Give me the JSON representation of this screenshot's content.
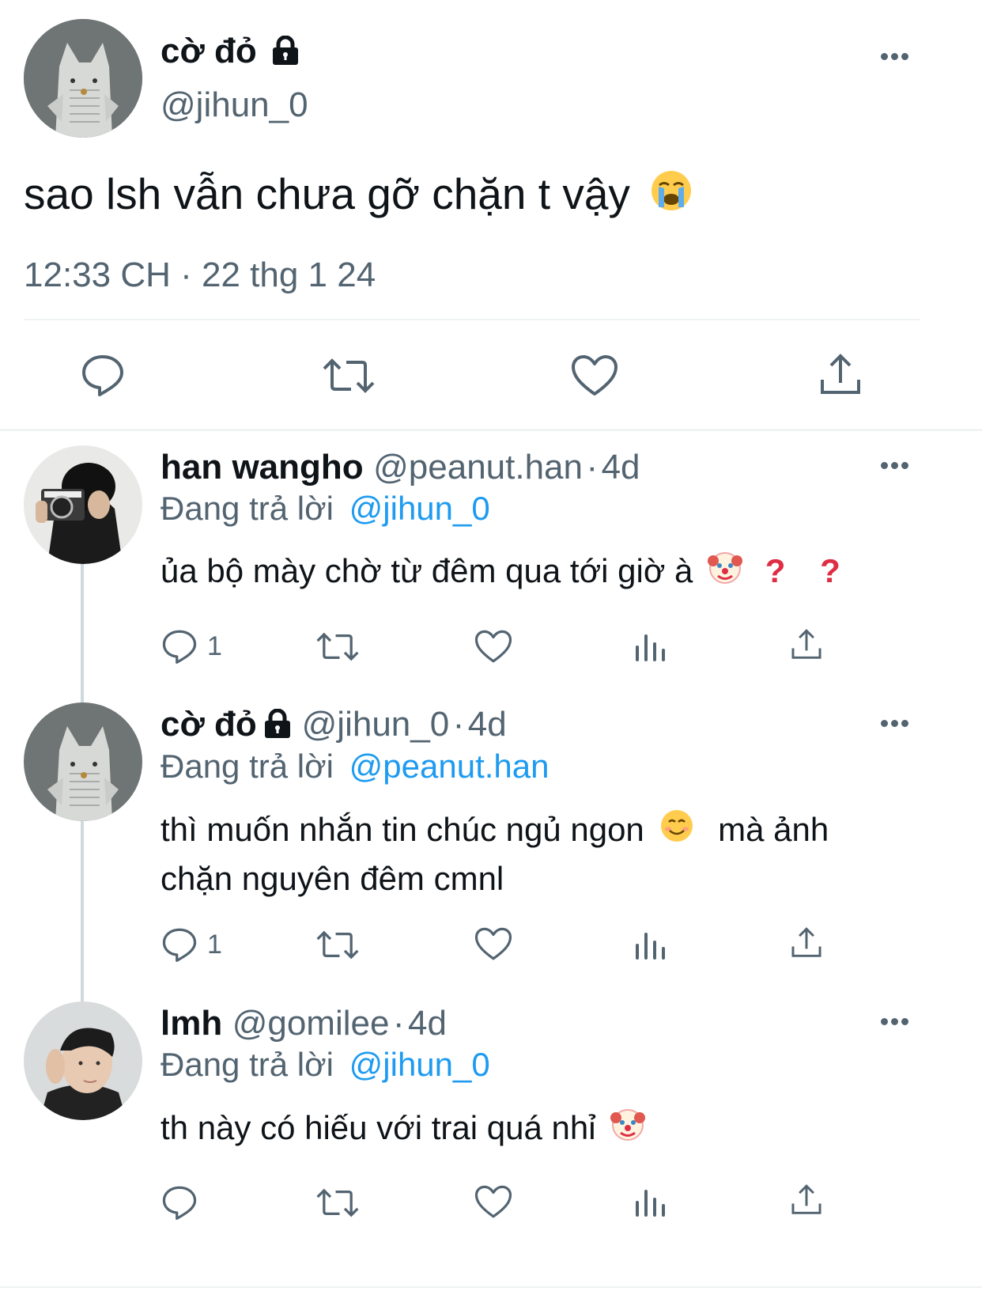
{
  "main_tweet": {
    "display_name": "cờ đỏ",
    "handle": "@jihun_0",
    "text": "sao lsh vẫn chưa gỡ chặn t vậy",
    "timestamp": "12:33 CH · 22 thg 1 24",
    "icons": [
      "reply-icon",
      "retweet-icon",
      "like-icon",
      "share-icon"
    ]
  },
  "replies": [
    {
      "display_name": "han wangho",
      "handle": "@peanut.han",
      "sep": "·",
      "age": "4d",
      "replying_label": "Đang trả lời",
      "replying_to": "@jihun_0",
      "text": "ủa bộ mày chờ từ đêm qua tới giờ à",
      "reply_count": "1"
    },
    {
      "display_name": "cờ đỏ",
      "handle": "@jihun_0",
      "sep": "·",
      "age": "4d",
      "replying_label": "Đang trả lời",
      "replying_to": "@peanut.han",
      "text_line1a": "thì muốn nhắn tin chúc ngủ ngon",
      "text_line1b": "mà ảnh",
      "text_line2": "chặn nguyên đêm cmnl",
      "reply_count": "1"
    },
    {
      "display_name": "lmh",
      "handle": "@gomilee",
      "sep": "·",
      "age": "4d",
      "replying_label": "Đang trả lời",
      "replying_to": "@jihun_0",
      "text": "th này có hiếu với trai quá nhỉ",
      "reply_count": ""
    }
  ],
  "colors": {
    "text": "#0f1419",
    "secondary": "#536471",
    "link": "#1d9bf0",
    "divider": "#eff3f4",
    "thread": "#cfd9de"
  }
}
